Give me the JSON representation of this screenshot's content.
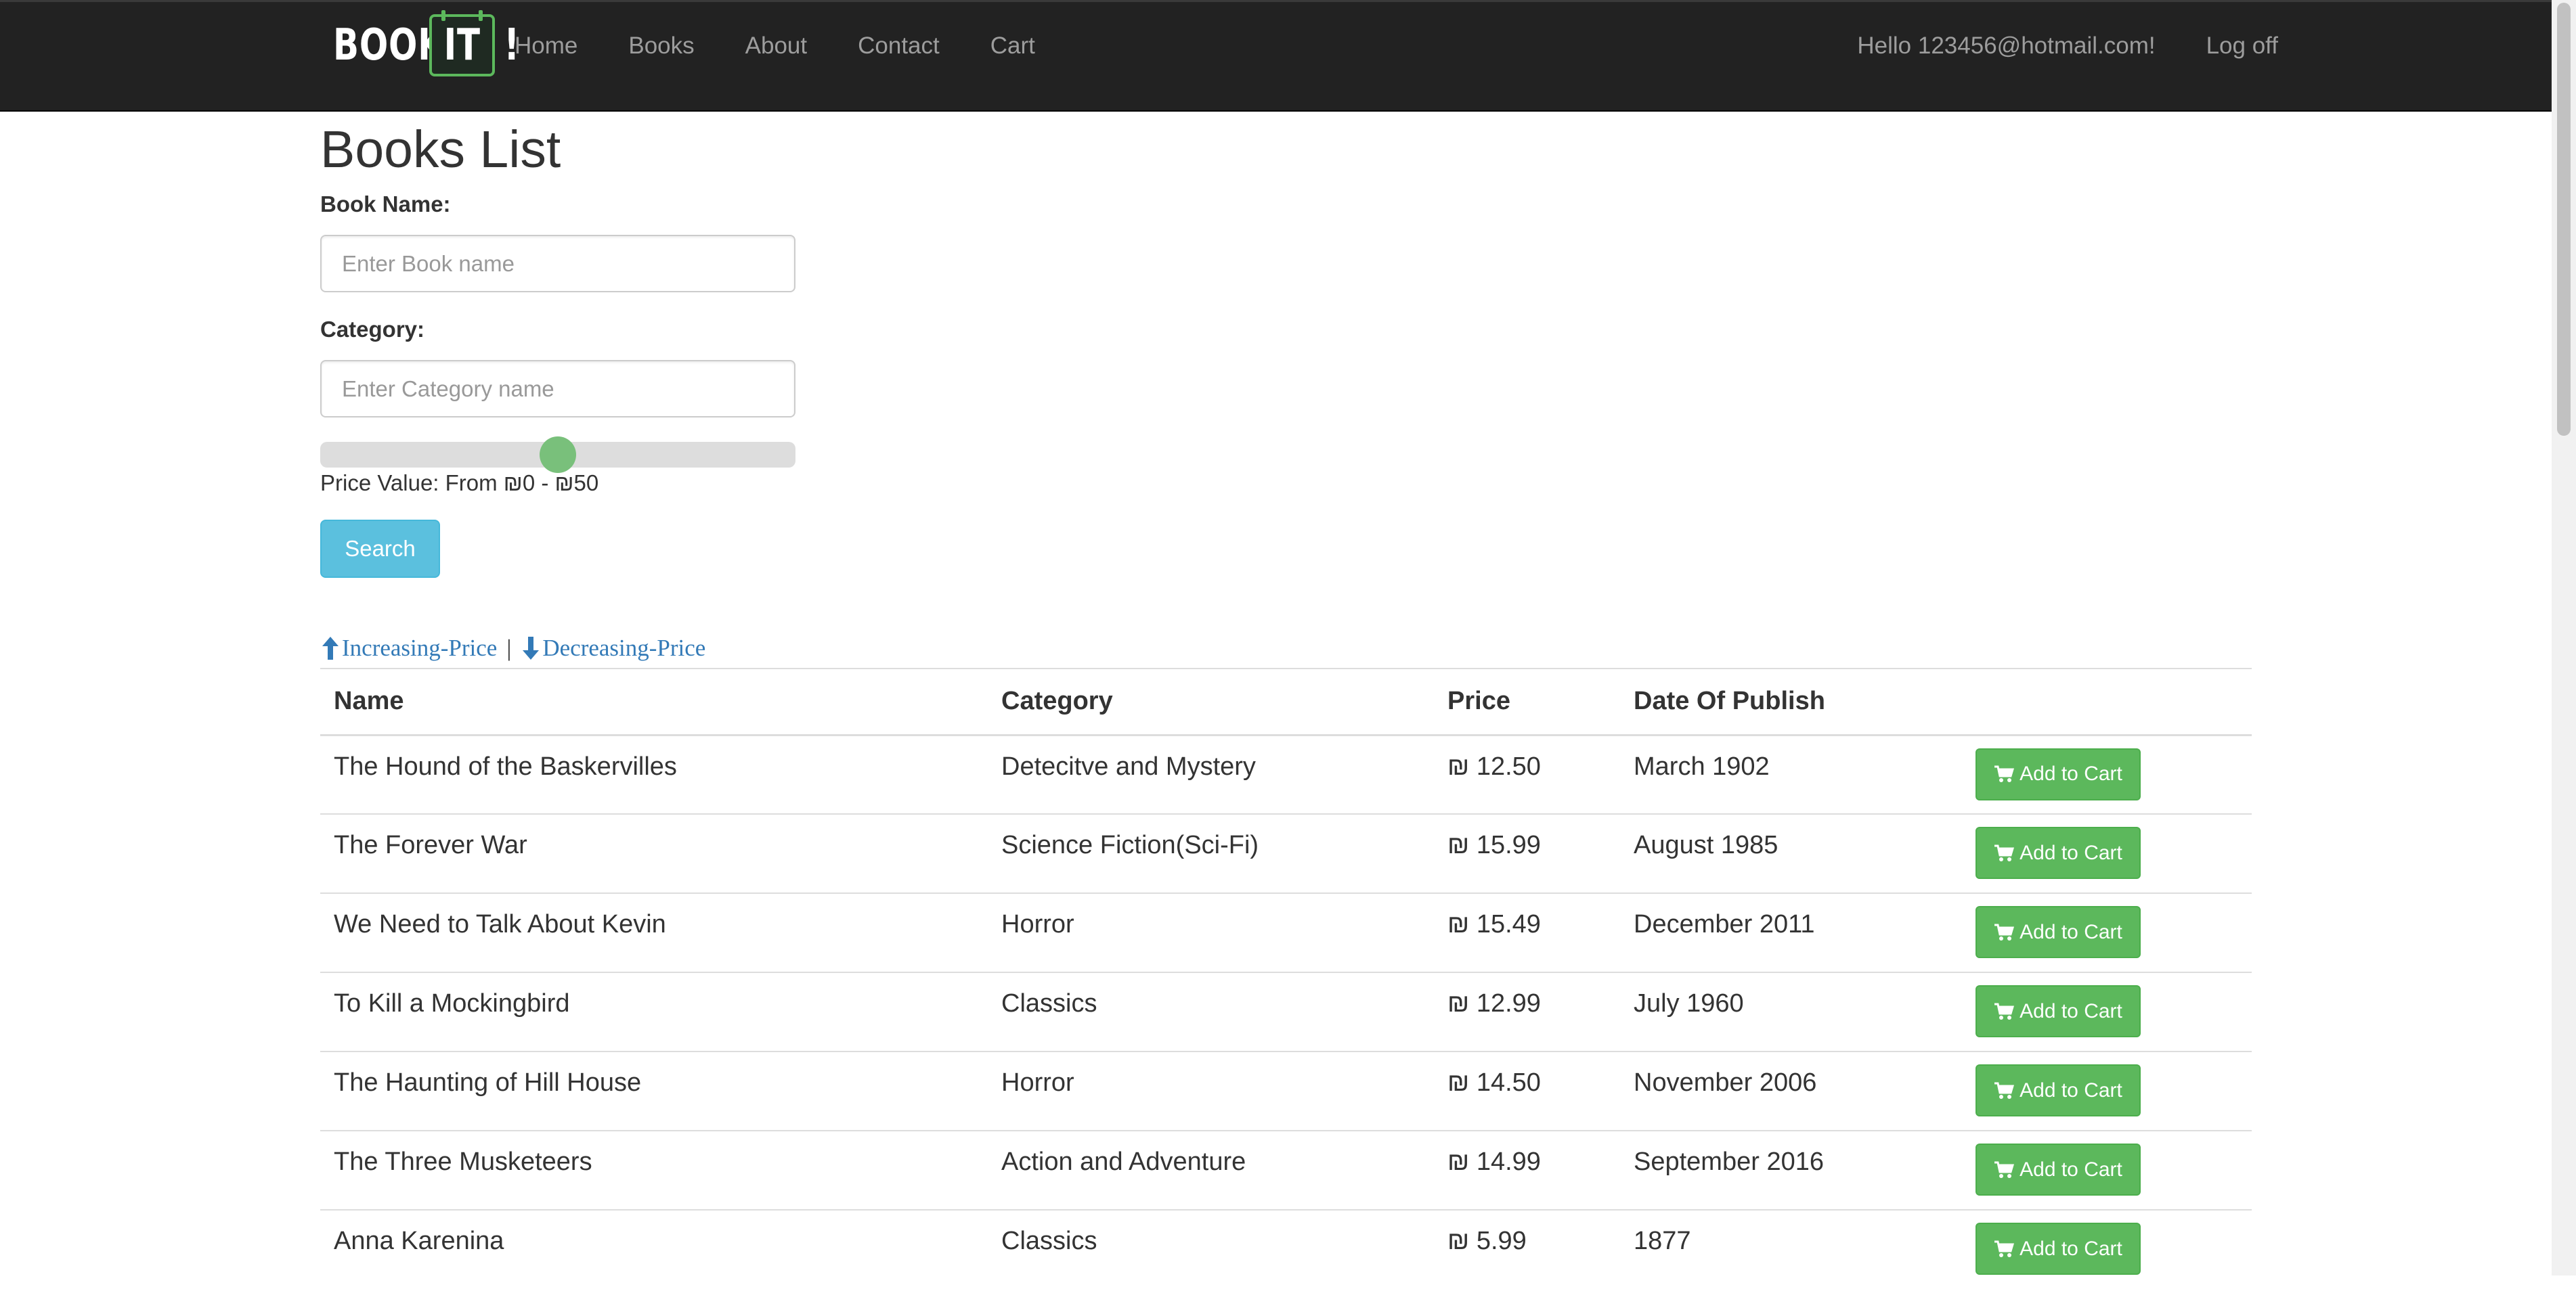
{
  "nav": {
    "brand": {
      "left": "BOOK",
      "boxed": "IT",
      "right": "!"
    },
    "links": [
      "Home",
      "Books",
      "About",
      "Contact",
      "Cart"
    ],
    "greeting": "Hello 123456@hotmail.com!",
    "logoff": "Log off"
  },
  "page": {
    "title": "Books List",
    "book_name_label": "Book Name:",
    "book_name_placeholder": "Enter Book name",
    "category_label": "Category:",
    "category_placeholder": "Enter Category name",
    "slider_value_fraction": 0.5,
    "price_text": "Price Value: From ₪0 - ₪50",
    "search_label": "Search",
    "sort_increasing": "Increasing-Price",
    "sort_separator": "|",
    "sort_decreasing": "Decreasing-Price"
  },
  "table": {
    "headers": {
      "name": "Name",
      "category": "Category",
      "price": "Price",
      "date": "Date Of Publish"
    },
    "add_label": "Add to Cart",
    "rows": [
      {
        "name": "The Hound of the Baskervilles",
        "category": "Detecitve and Mystery",
        "price": "₪ 12.50",
        "date": "March 1902"
      },
      {
        "name": "The Forever War",
        "category": "Science Fiction(Sci-Fi)",
        "price": "₪ 15.99",
        "date": "August 1985"
      },
      {
        "name": "We Need to Talk About Kevin",
        "category": "Horror",
        "price": "₪ 15.49",
        "date": "December 2011"
      },
      {
        "name": "To Kill a Mockingbird",
        "category": "Classics",
        "price": "₪ 12.99",
        "date": "July 1960"
      },
      {
        "name": "The Haunting of Hill House",
        "category": "Horror",
        "price": "₪ 14.50",
        "date": "November 2006"
      },
      {
        "name": "The Three Musketeers",
        "category": "Action and Adventure",
        "price": "₪ 14.99",
        "date": "September 2016"
      },
      {
        "name": "Anna Karenina",
        "category": "Classics",
        "price": "₪ 5.99",
        "date": "1877"
      }
    ]
  },
  "colors": {
    "navbar": "#222222",
    "nav_text": "#9d9d9d",
    "brand_accent": "#5cb85c",
    "search_button": "#5bc0de",
    "add_button": "#5cb85c",
    "link": "#337ab7",
    "slider_thumb": "#79c07b"
  },
  "icons": {
    "sort_up": "arrow-up-icon",
    "sort_down": "arrow-down-icon",
    "cart": "shopping-cart-icon"
  }
}
